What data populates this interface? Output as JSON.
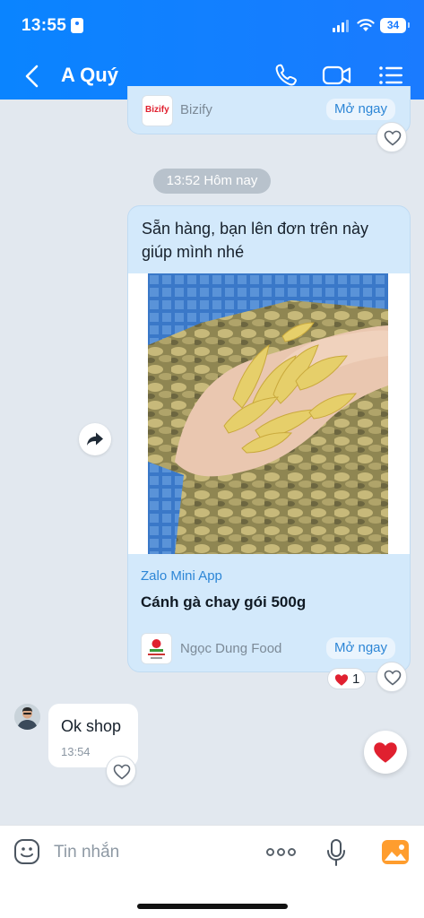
{
  "status_bar": {
    "time": "13:55",
    "battery": "34"
  },
  "header": {
    "title": "A Quý"
  },
  "prev_card": {
    "app_name": "Bizify",
    "logo_text": "Bizify",
    "open_label": "Mở ngay"
  },
  "time_separator": "13:52 Hôm nay",
  "product_message": {
    "text_line1": "Sẵn hàng, bạn lên đơn trên này",
    "text_line2": "giúp mình nhé",
    "mini_app_label": "Zalo Mini App",
    "product_title": "Cánh gà chay gói 500g",
    "shop_name": "Ngọc Dung Food",
    "open_label": "Mở ngay",
    "reaction_count": "1"
  },
  "reply": {
    "text": "Ok shop",
    "time": "13:54"
  },
  "composer": {
    "placeholder": "Tin nhắn"
  },
  "colors": {
    "header": "#1a7bff",
    "heart": "#e0202f",
    "card": "#d3e9fb",
    "link": "#2d86d6"
  }
}
